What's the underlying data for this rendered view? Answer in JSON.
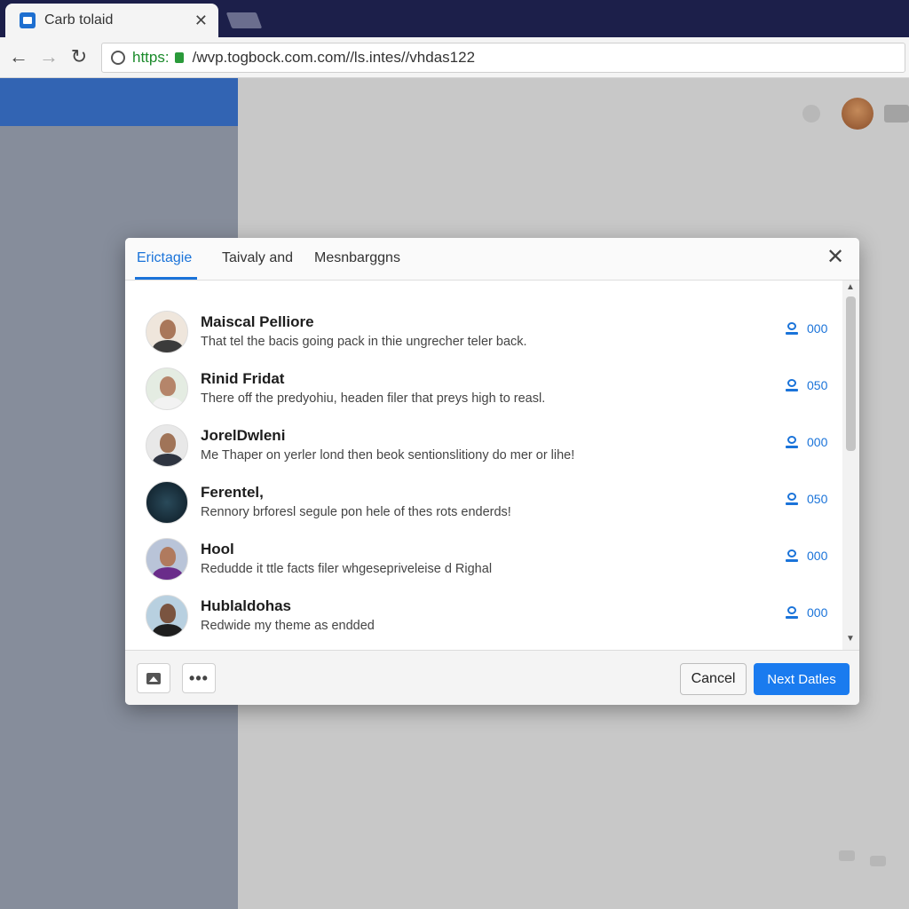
{
  "browser": {
    "tab_title": "Carb tolaid",
    "tab_close": "✕",
    "url_scheme": "https:",
    "url_rest": "/wvp.togbock.com.com//ls.intes//vhdas122",
    "nav": {
      "back": "←",
      "forward": "→",
      "reload": "↻"
    }
  },
  "dialog": {
    "tabs": [
      {
        "label": "Erictagie",
        "active": true
      },
      {
        "label": "Taivaly and"
      },
      {
        "label": "Mesnbarggns"
      }
    ],
    "close": "✕",
    "contacts": [
      {
        "name": "Maiscal Pelliore",
        "snippet": "That tel the bacis going pack in thie ungrecher teler back.",
        "count": "000"
      },
      {
        "name": "Rinid Fridat",
        "snippet": "There off the predyohiu, headen filer that preys high to reasl.",
        "count": "050"
      },
      {
        "name": "JorelDwleni",
        "snippet": "Me Thaper on yerler lond then beok sentionslitiony do mer or lihe!",
        "count": "000"
      },
      {
        "name": "Ferentel,",
        "snippet": "Rennory brforesl segule pon hele of thes rots enderds!",
        "count": "050"
      },
      {
        "name": "Hool",
        "snippet": "Redudde it ttle facts filer whgesepriveleise d Righal",
        "count": "000"
      },
      {
        "name": "Hublaldohas",
        "snippet": "Redwide my theme as endded",
        "count": "000"
      }
    ],
    "footer": {
      "more_label": "•••",
      "cancel_label": "Cancel",
      "next_label": "Next Datles"
    }
  },
  "colors": {
    "accent": "#1a73d9",
    "primary_button": "#1a7bef",
    "tab_bar": "#1c1f4a",
    "sidebar_header": "#3264b3"
  }
}
